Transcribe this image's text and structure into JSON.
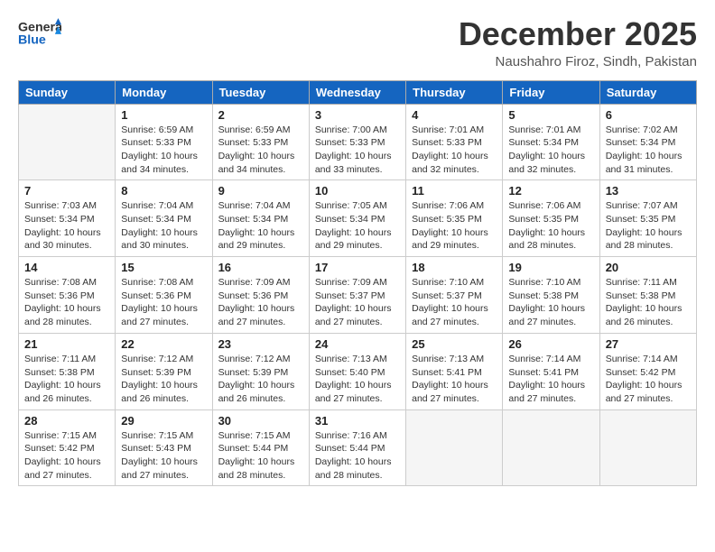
{
  "header": {
    "logo_general": "General",
    "logo_blue": "Blue",
    "month": "December 2025",
    "location": "Naushahro Firoz, Sindh, Pakistan"
  },
  "days_of_week": [
    "Sunday",
    "Monday",
    "Tuesday",
    "Wednesday",
    "Thursday",
    "Friday",
    "Saturday"
  ],
  "weeks": [
    [
      {
        "num": "",
        "sunrise": "",
        "sunset": "",
        "daylight": "",
        "empty": true
      },
      {
        "num": "1",
        "sunrise": "Sunrise: 6:59 AM",
        "sunset": "Sunset: 5:33 PM",
        "daylight": "Daylight: 10 hours and 34 minutes."
      },
      {
        "num": "2",
        "sunrise": "Sunrise: 6:59 AM",
        "sunset": "Sunset: 5:33 PM",
        "daylight": "Daylight: 10 hours and 34 minutes."
      },
      {
        "num": "3",
        "sunrise": "Sunrise: 7:00 AM",
        "sunset": "Sunset: 5:33 PM",
        "daylight": "Daylight: 10 hours and 33 minutes."
      },
      {
        "num": "4",
        "sunrise": "Sunrise: 7:01 AM",
        "sunset": "Sunset: 5:33 PM",
        "daylight": "Daylight: 10 hours and 32 minutes."
      },
      {
        "num": "5",
        "sunrise": "Sunrise: 7:01 AM",
        "sunset": "Sunset: 5:34 PM",
        "daylight": "Daylight: 10 hours and 32 minutes."
      },
      {
        "num": "6",
        "sunrise": "Sunrise: 7:02 AM",
        "sunset": "Sunset: 5:34 PM",
        "daylight": "Daylight: 10 hours and 31 minutes."
      }
    ],
    [
      {
        "num": "7",
        "sunrise": "Sunrise: 7:03 AM",
        "sunset": "Sunset: 5:34 PM",
        "daylight": "Daylight: 10 hours and 30 minutes."
      },
      {
        "num": "8",
        "sunrise": "Sunrise: 7:04 AM",
        "sunset": "Sunset: 5:34 PM",
        "daylight": "Daylight: 10 hours and 30 minutes."
      },
      {
        "num": "9",
        "sunrise": "Sunrise: 7:04 AM",
        "sunset": "Sunset: 5:34 PM",
        "daylight": "Daylight: 10 hours and 29 minutes."
      },
      {
        "num": "10",
        "sunrise": "Sunrise: 7:05 AM",
        "sunset": "Sunset: 5:34 PM",
        "daylight": "Daylight: 10 hours and 29 minutes."
      },
      {
        "num": "11",
        "sunrise": "Sunrise: 7:06 AM",
        "sunset": "Sunset: 5:35 PM",
        "daylight": "Daylight: 10 hours and 29 minutes."
      },
      {
        "num": "12",
        "sunrise": "Sunrise: 7:06 AM",
        "sunset": "Sunset: 5:35 PM",
        "daylight": "Daylight: 10 hours and 28 minutes."
      },
      {
        "num": "13",
        "sunrise": "Sunrise: 7:07 AM",
        "sunset": "Sunset: 5:35 PM",
        "daylight": "Daylight: 10 hours and 28 minutes."
      }
    ],
    [
      {
        "num": "14",
        "sunrise": "Sunrise: 7:08 AM",
        "sunset": "Sunset: 5:36 PM",
        "daylight": "Daylight: 10 hours and 28 minutes."
      },
      {
        "num": "15",
        "sunrise": "Sunrise: 7:08 AM",
        "sunset": "Sunset: 5:36 PM",
        "daylight": "Daylight: 10 hours and 27 minutes."
      },
      {
        "num": "16",
        "sunrise": "Sunrise: 7:09 AM",
        "sunset": "Sunset: 5:36 PM",
        "daylight": "Daylight: 10 hours and 27 minutes."
      },
      {
        "num": "17",
        "sunrise": "Sunrise: 7:09 AM",
        "sunset": "Sunset: 5:37 PM",
        "daylight": "Daylight: 10 hours and 27 minutes."
      },
      {
        "num": "18",
        "sunrise": "Sunrise: 7:10 AM",
        "sunset": "Sunset: 5:37 PM",
        "daylight": "Daylight: 10 hours and 27 minutes."
      },
      {
        "num": "19",
        "sunrise": "Sunrise: 7:10 AM",
        "sunset": "Sunset: 5:38 PM",
        "daylight": "Daylight: 10 hours and 27 minutes."
      },
      {
        "num": "20",
        "sunrise": "Sunrise: 7:11 AM",
        "sunset": "Sunset: 5:38 PM",
        "daylight": "Daylight: 10 hours and 26 minutes."
      }
    ],
    [
      {
        "num": "21",
        "sunrise": "Sunrise: 7:11 AM",
        "sunset": "Sunset: 5:38 PM",
        "daylight": "Daylight: 10 hours and 26 minutes."
      },
      {
        "num": "22",
        "sunrise": "Sunrise: 7:12 AM",
        "sunset": "Sunset: 5:39 PM",
        "daylight": "Daylight: 10 hours and 26 minutes."
      },
      {
        "num": "23",
        "sunrise": "Sunrise: 7:12 AM",
        "sunset": "Sunset: 5:39 PM",
        "daylight": "Daylight: 10 hours and 26 minutes."
      },
      {
        "num": "24",
        "sunrise": "Sunrise: 7:13 AM",
        "sunset": "Sunset: 5:40 PM",
        "daylight": "Daylight: 10 hours and 27 minutes."
      },
      {
        "num": "25",
        "sunrise": "Sunrise: 7:13 AM",
        "sunset": "Sunset: 5:41 PM",
        "daylight": "Daylight: 10 hours and 27 minutes."
      },
      {
        "num": "26",
        "sunrise": "Sunrise: 7:14 AM",
        "sunset": "Sunset: 5:41 PM",
        "daylight": "Daylight: 10 hours and 27 minutes."
      },
      {
        "num": "27",
        "sunrise": "Sunrise: 7:14 AM",
        "sunset": "Sunset: 5:42 PM",
        "daylight": "Daylight: 10 hours and 27 minutes."
      }
    ],
    [
      {
        "num": "28",
        "sunrise": "Sunrise: 7:15 AM",
        "sunset": "Sunset: 5:42 PM",
        "daylight": "Daylight: 10 hours and 27 minutes."
      },
      {
        "num": "29",
        "sunrise": "Sunrise: 7:15 AM",
        "sunset": "Sunset: 5:43 PM",
        "daylight": "Daylight: 10 hours and 27 minutes."
      },
      {
        "num": "30",
        "sunrise": "Sunrise: 7:15 AM",
        "sunset": "Sunset: 5:44 PM",
        "daylight": "Daylight: 10 hours and 28 minutes."
      },
      {
        "num": "31",
        "sunrise": "Sunrise: 7:16 AM",
        "sunset": "Sunset: 5:44 PM",
        "daylight": "Daylight: 10 hours and 28 minutes."
      },
      {
        "num": "",
        "sunrise": "",
        "sunset": "",
        "daylight": "",
        "empty": true
      },
      {
        "num": "",
        "sunrise": "",
        "sunset": "",
        "daylight": "",
        "empty": true
      },
      {
        "num": "",
        "sunrise": "",
        "sunset": "",
        "daylight": "",
        "empty": true
      }
    ]
  ]
}
